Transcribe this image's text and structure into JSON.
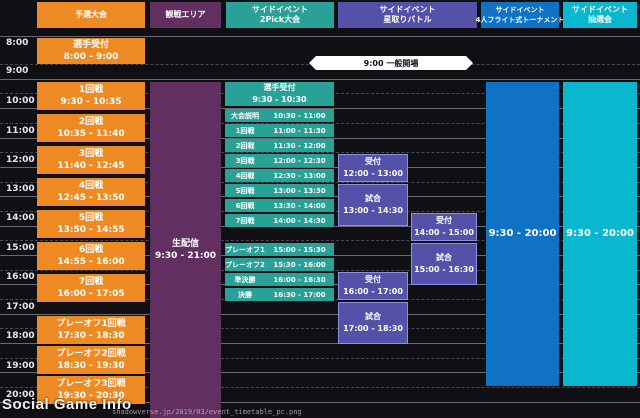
{
  "headers": [
    {
      "key": "yosen",
      "line1": "予選大会",
      "line2": "",
      "color": "#ee8a24"
    },
    {
      "key": "kansen",
      "line1": "観戦エリア",
      "line2": "",
      "color": "#623060"
    },
    {
      "key": "2pick",
      "line1": "サイドイベント",
      "line2": "2Pick大会",
      "color": "#2aa197"
    },
    {
      "key": "hoshitori",
      "line1": "サイドイベント",
      "line2": "星取りバトル",
      "color": "#5352a8"
    },
    {
      "key": "4flight",
      "line1": "サイドイベント",
      "line2": "4人フライト式トーナメント",
      "color": "#0f72c4"
    },
    {
      "key": "chusen",
      "line1": "サイドイベント",
      "line2": "抽選会",
      "color": "#0ab7ce"
    }
  ],
  "times": [
    "8:00",
    "9:00",
    "10:00",
    "11:00",
    "12:00",
    "13:00",
    "14:00",
    "15:00",
    "16:00",
    "17:00",
    "18:00",
    "19:00",
    "20:00"
  ],
  "announcement": "9:00 一般開場",
  "yosen_blocks": [
    {
      "title": "選手受付",
      "time": "8:00 - 9:00"
    },
    {
      "title": "1回戦",
      "time": "9:30 - 10:35"
    },
    {
      "title": "2回戦",
      "time": "10:35 - 11:40"
    },
    {
      "title": "3回戦",
      "time": "11:40 - 12:45"
    },
    {
      "title": "4回戦",
      "time": "12:45 - 13:50"
    },
    {
      "title": "5回戦",
      "time": "13:50 - 14:55"
    },
    {
      "title": "6回戦",
      "time": "14:55 - 16:00"
    },
    {
      "title": "7回戦",
      "time": "16:00 - 17:05"
    },
    {
      "title": "プレーオフ1回戦",
      "time": "17:30 - 18:30"
    },
    {
      "title": "プレーオフ2回戦",
      "time": "18:30 - 19:30"
    },
    {
      "title": "プレーオフ3回戦",
      "time": "19:30 - 20:30"
    }
  ],
  "kansen_block": {
    "title": "生配信",
    "time": "9:30 - 21:00"
  },
  "pick2_reception": {
    "title": "選手受付",
    "time": "9:30 - 10:30"
  },
  "pick2_rows": [
    {
      "label": "大会説明",
      "time": "10:30 - 11:00"
    },
    {
      "label": "1回戦",
      "time": "11:00 - 11:30"
    },
    {
      "label": "2回戦",
      "time": "11:30 - 12:00"
    },
    {
      "label": "3回戦",
      "time": "12:00 - 12:30"
    },
    {
      "label": "4回戦",
      "time": "12:30 - 13:00"
    },
    {
      "label": "5回戦",
      "time": "13:00 - 13:30"
    },
    {
      "label": "6回戦",
      "time": "13:30 - 14:00"
    },
    {
      "label": "7回戦",
      "time": "14:00 - 14:30"
    },
    {
      "label": "プレーオフ1回戦",
      "time": "15:00 - 15:30"
    },
    {
      "label": "プレーオフ2回戦",
      "time": "15:30 - 16:00"
    },
    {
      "label": "準決勝",
      "time": "16:00 - 16:30"
    },
    {
      "label": "決勝",
      "time": "16:30 - 17:00"
    }
  ],
  "hoshitori_blocks": [
    {
      "title": "受付",
      "time": "12:00 - 13:00"
    },
    {
      "title": "試合",
      "time": "13:00 - 14:30"
    },
    {
      "title": "受付",
      "time": "16:00 - 17:00"
    },
    {
      "title": "試合",
      "time": "17:00 - 18:30"
    }
  ],
  "hoshitori_blocks2": [
    {
      "title": "受付",
      "time": "14:00 - 15:00"
    },
    {
      "title": "試合",
      "time": "15:00 - 16:30"
    }
  ],
  "flight_block": {
    "time": "9:30 - 20:00"
  },
  "chusen_block": {
    "time": "9:30 - 20:00"
  },
  "watermark": "Social Game Info",
  "watermark_url": "shadowverse.jp/2019/03/event_timetable_pc.png",
  "colors": {
    "orange": "#ee8a24",
    "purple": "#623060",
    "teal": "#2aa197",
    "violet": "#5352a8",
    "blue": "#0f72c4",
    "cyan": "#0ab7ce"
  }
}
